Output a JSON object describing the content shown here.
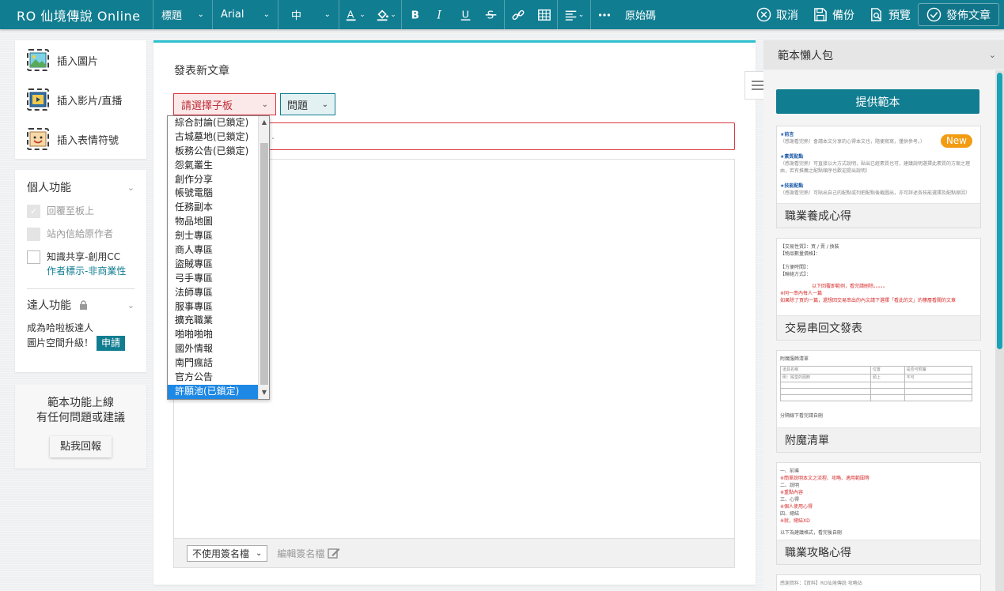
{
  "toolbar": {
    "brand": "RO 仙境傳說 Online",
    "heading_select": "標題",
    "font_select": "Arial",
    "size_select": "中",
    "source_label": "原始碼",
    "cancel_label": "取消",
    "backup_label": "備份",
    "preview_label": "預覽",
    "publish_label": "發佈文章"
  },
  "left": {
    "insert_image": "插入圖片",
    "insert_video": "插入影片/直播",
    "insert_emoji": "插入表情符號",
    "personal_title": "個人功能",
    "reply_top": "回覆至板上",
    "pm_author": "站內信給原作者",
    "cc_share": "知識共享-創用CC",
    "cc_sub": "作者標示-非商業性",
    "expert_title": "達人功能",
    "promo_l1": "成為哈啦板達人",
    "promo_l2": "圖片空間升級！",
    "apply_label": "申請",
    "feedback_l1": "範本功能上線",
    "feedback_l2": "有任何問題或建議",
    "feedback_btn": "點我回報"
  },
  "editor": {
    "title": "發表新文章",
    "board_select": "請選擇子板",
    "category_select": "問題",
    "title_input_placeholder": "",
    "title_input_hint": ".",
    "signature_select": "不使用簽名檔",
    "edit_signature": "編輯簽名檔"
  },
  "dropdown": {
    "selected_index": 19,
    "options": [
      "綜合討論(已鎖定)",
      "古城墓地(已鎖定)",
      "板務公告(已鎖定)",
      "怨氣叢生",
      "創作分享",
      "帳號電腦",
      "任務副本",
      "物品地圖",
      "劍士專區",
      "商人專區",
      "盜賊專區",
      "弓手專區",
      "法師專區",
      "服事專區",
      "擴充職業",
      "啪啪啪啪",
      "國外情報",
      "南門瘋話",
      "官方公告",
      "許願池(已鎖定)"
    ]
  },
  "right": {
    "panel_title": "範本懶人包",
    "provide_btn": "提供範本",
    "new_badge": "New",
    "templates": [
      {
        "name": "職業養成心得"
      },
      {
        "name": "交易串回文發表"
      },
      {
        "name": "附魔清單"
      },
      {
        "name": "職業攻略心得"
      }
    ],
    "preview1": {
      "h1": "★前言",
      "t1": "（感謝看完熱！會請本文分享的心得本文也，隨便寫寫，僅供參考。）",
      "h2": "★素質配點",
      "t2": "（感謝看完熱！可直接以大方式說明，貼出已經素質也可，建議說明選擇此素質的方案之理由，若有推薦之配點順序也歡迎提出說明）",
      "h3": "★技能配點",
      "t3": "（感謝看完熱！可貼出自己的配點或列把配點後截圖出，亦可詳述各技能選擇及配點原因）"
    },
    "preview2": {
      "l1": "【交易性質】：買 / 賣 / 換裝",
      "l2": "【物品數量價格】：",
      "l3": "【方便時間】：",
      "l4": "【聯絡方式】：",
      "r1": "以下回覆即範例，看完請刪除。。。。。",
      "r2": "※同一串內每人一篇",
      "r3": "如果除了買的一篇，還想回交易串出的內文請下選擇「看此的文」的樓層看關的文章"
    },
    "preview3": {
      "title": "附魔服飾清單",
      "c1": "道具名稱",
      "c2": "位置",
      "c3": "是否可附魔",
      "r1": "例：殿堂的頭飾",
      "r2": "頭上",
      "r3": "不可",
      "foot": "分隔線下看完請自刪"
    },
    "preview4": {
      "l1": "一、前導",
      "l2": "※簡單說明本文之流程、攻略、適用範圍等",
      "l3": "二、說明",
      "l4": "※重點內容",
      "l5": "三、心得",
      "l6": "※個人使用心得",
      "l7": "四、總結",
      "l8": "※就，總結XD",
      "l9": "以下為建議格式，看完後自刪"
    },
    "preview5": {
      "l1": "感謝資料：【資料】RO仙境傳說  攻略站"
    }
  }
}
